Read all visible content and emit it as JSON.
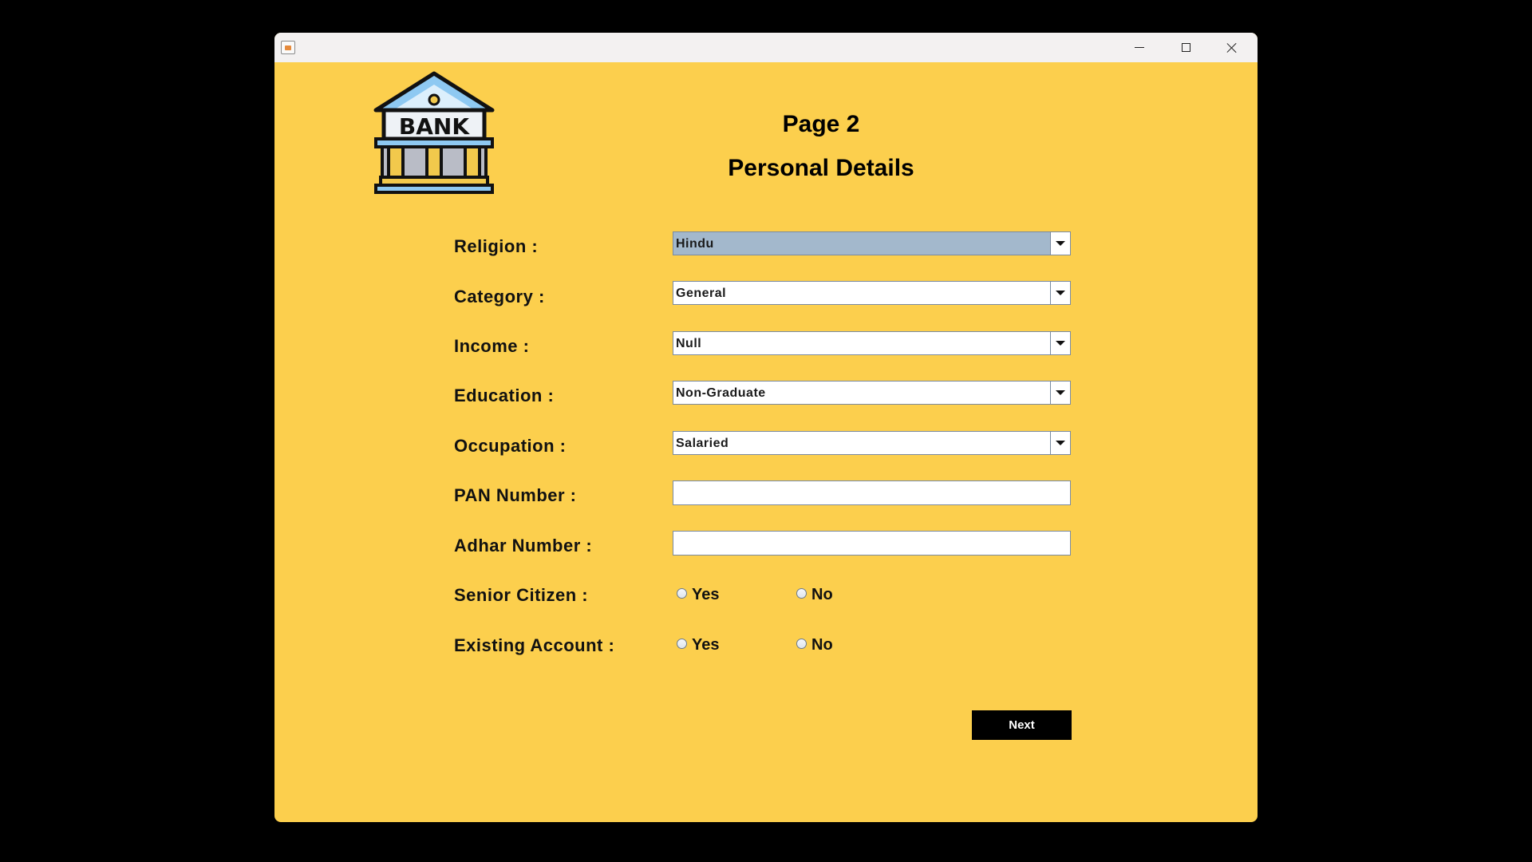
{
  "window": {
    "controls": {
      "minimize": "minimize-icon",
      "maximize": "maximize-icon",
      "close": "close-icon"
    },
    "background": "#FCCF4D",
    "titlebar_color": "#F3F1F1"
  },
  "logo": {
    "text": "BANK"
  },
  "header": {
    "page": "Page 2",
    "title": "Personal Details"
  },
  "form": {
    "religion": {
      "label": "Religion :",
      "value": "Hindu"
    },
    "category": {
      "label": "Category :",
      "value": "General"
    },
    "income": {
      "label": "Income :",
      "value": "Null"
    },
    "education": {
      "label": "Education :",
      "value": "Non-Graduate"
    },
    "occupation": {
      "label": "Occupation :",
      "value": "Salaried"
    },
    "pan": {
      "label": "PAN Number :",
      "value": ""
    },
    "adhar": {
      "label": "Adhar Number :",
      "value": ""
    },
    "senior_citizen": {
      "label": "Senior Citizen :",
      "yes": "Yes",
      "no": "No"
    },
    "existing_account": {
      "label": "Existing Account :",
      "yes": "Yes",
      "no": "No"
    }
  },
  "buttons": {
    "next": "Next"
  },
  "colors": {
    "selected_combo": "#A3B8CC",
    "button_bg": "#000000",
    "button_text": "#FFFFFF"
  }
}
